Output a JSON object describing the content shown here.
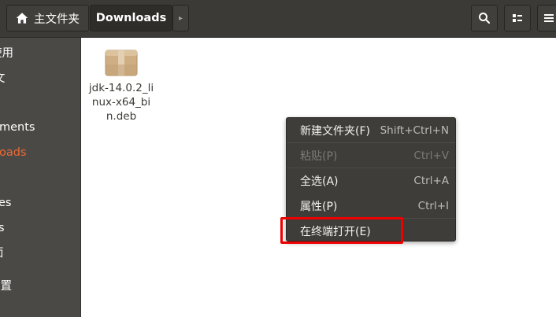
{
  "header": {
    "breadcrumbs": [
      "主文件夹",
      "Downloads"
    ],
    "next_arrow": "▸"
  },
  "sidebar": {
    "items": [
      {
        "label": "使用"
      },
      {
        "label": "文"
      },
      {
        "label": "ments"
      },
      {
        "label": "oads"
      },
      {
        "label": "es"
      },
      {
        "label": "s"
      },
      {
        "label": "面"
      },
      {
        "label": "设置"
      }
    ]
  },
  "files": [
    {
      "name": "jdk-14.0.2_linux-x64_bin.deb"
    }
  ],
  "context_menu": {
    "items": [
      {
        "label": "新建文件夹(F)",
        "shortcut": "Shift+Ctrl+N"
      },
      {
        "label": "粘贴(P)",
        "shortcut": "Ctrl+V"
      },
      {
        "label": "全选(A)",
        "shortcut": "Ctrl+A"
      },
      {
        "label": "属性(P)",
        "shortcut": "Ctrl+I"
      },
      {
        "label": "在终端打开(E)",
        "shortcut": ""
      }
    ]
  },
  "colors": {
    "header_bg": "#3b3a36",
    "sidebar_bg": "#4a4945",
    "accent_active": "#ee6a33",
    "menu_bg": "#3e3d39",
    "highlight_box": "#ee0000"
  },
  "icons": [
    "home-icon",
    "search-icon",
    "view-toggle-icon",
    "hamburger-menu-icon",
    "archive-package-icon"
  ]
}
